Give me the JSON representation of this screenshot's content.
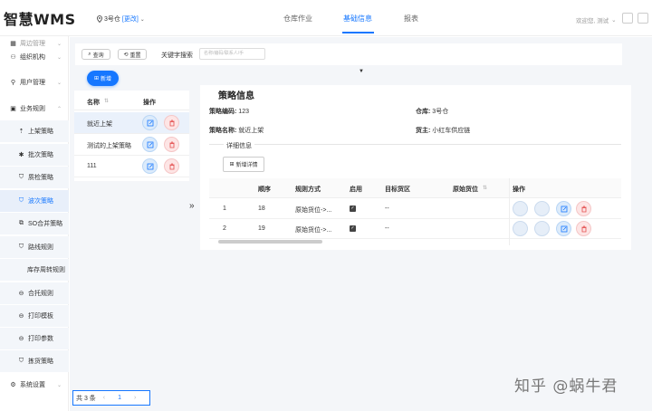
{
  "app": {
    "logo": "智慧WMS"
  },
  "header": {
    "warehouse": "3号仓",
    "change": "[更改]",
    "nav": [
      {
        "label": "仓库作业"
      },
      {
        "label": "基础信息"
      },
      {
        "label": "报表"
      }
    ],
    "welcome": "欢迎您, 测试"
  },
  "sidebar": {
    "items": [
      {
        "label": "周边管理"
      },
      {
        "label": "组织机构"
      },
      {
        "label": "用户管理"
      },
      {
        "label": "业务规则"
      },
      {
        "label": "上架策略"
      },
      {
        "label": "批次策略"
      },
      {
        "label": "质检策略"
      },
      {
        "label": "波次策略"
      },
      {
        "label": "SO合并策略"
      },
      {
        "label": "路线规则"
      },
      {
        "label": "库存周转规则"
      },
      {
        "label": "合托规则"
      },
      {
        "label": "打印模板"
      },
      {
        "label": "打印参数"
      },
      {
        "label": "拣货策略"
      },
      {
        "label": "系统设置"
      }
    ]
  },
  "toolbar": {
    "query": "查询",
    "reset": "重置",
    "keyword_label": "关键字搜索",
    "keyword_placeholder": "名称/编码/联系人/手"
  },
  "list": {
    "new_label": "新增",
    "col_name": "名称",
    "col_ops": "操作",
    "rows": [
      {
        "name": "就近上架"
      },
      {
        "name": "测试的上架策略"
      },
      {
        "name": "111"
      }
    ],
    "pager": {
      "total": "共 3 条",
      "page": "1"
    }
  },
  "detail": {
    "title": "策略信息",
    "code_label": "策略编码:",
    "code_value": "123",
    "warehouse_label": "仓库:",
    "warehouse_value": "3号仓",
    "name_label": "策略名称:",
    "name_value": "就近上架",
    "owner_label": "货主:",
    "owner_value": "小红车供应链",
    "sub_title": "详细信息",
    "add_detail_label": "新增详情",
    "columns": [
      "顺序",
      "规则方式",
      "启用",
      "目标货区",
      "原始货位",
      "操作"
    ],
    "rows": [
      {
        "idx": "1",
        "order": "18",
        "method": "原始货位->...",
        "target": "--"
      },
      {
        "idx": "2",
        "order": "19",
        "method": "原始货位->...",
        "target": "--"
      }
    ]
  },
  "watermark": "知乎 @蜗牛君"
}
